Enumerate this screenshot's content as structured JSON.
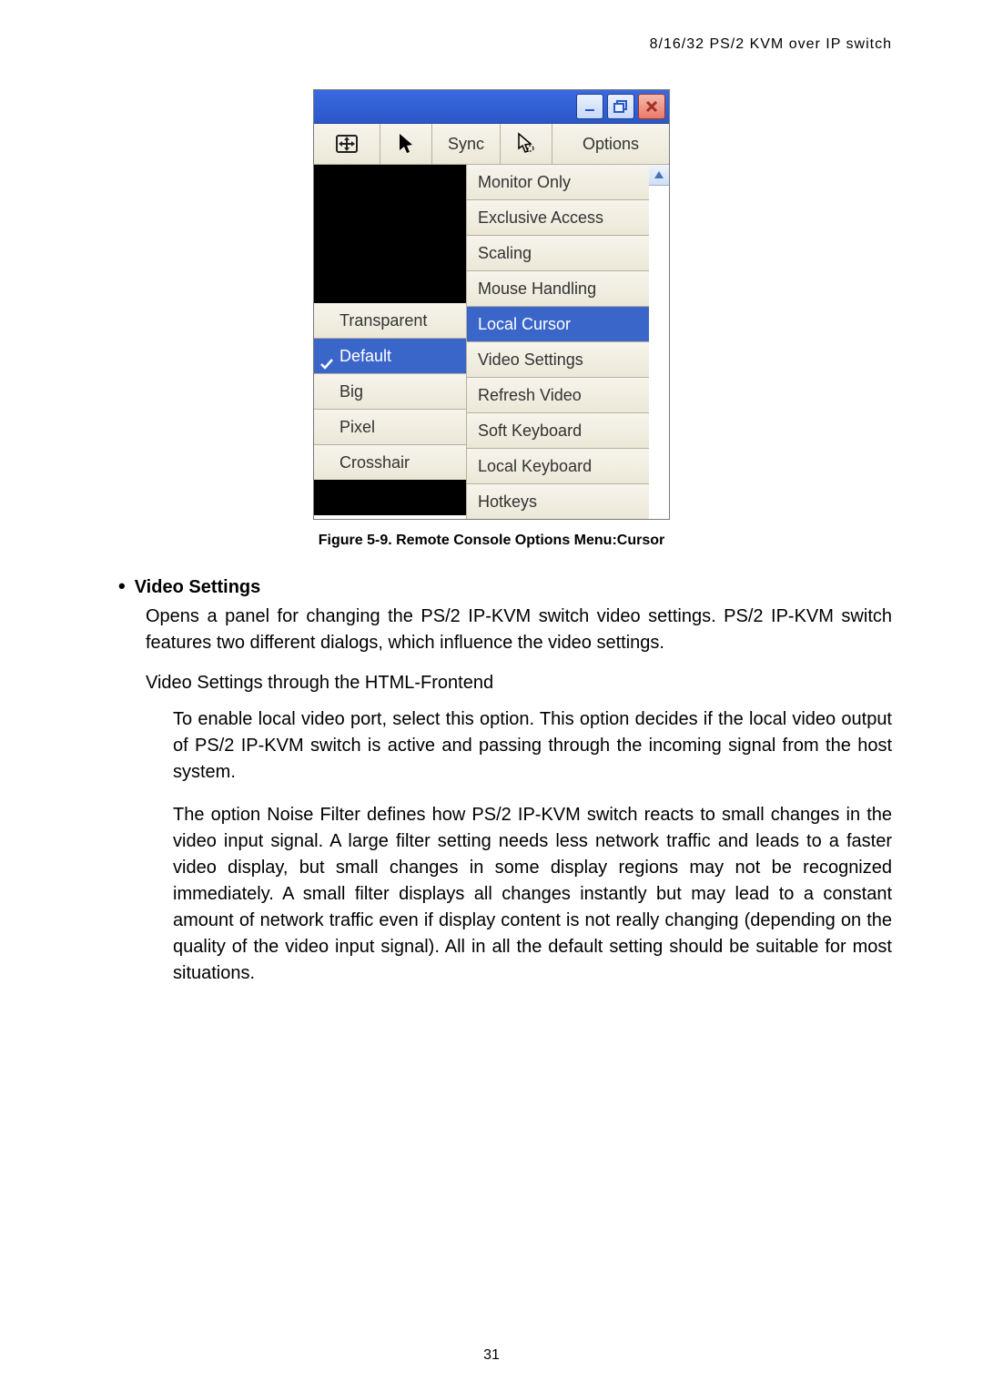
{
  "header": "8/16/32 PS/2 KVM over IP switch",
  "page_number": "31",
  "figure": {
    "caption": "Figure 5-9. Remote Console Options Menu:Cursor",
    "toolbar": {
      "sync": "Sync",
      "options": "Options"
    },
    "left_menu": {
      "transparent": "Transparent",
      "default": "Default",
      "big": "Big",
      "pixel": "Pixel",
      "crosshair": "Crosshair"
    },
    "right_menu": {
      "monitor_only": "Monitor Only",
      "exclusive_access": "Exclusive Access",
      "scaling": "Scaling",
      "mouse_handling": "Mouse Handling",
      "local_cursor": "Local Cursor",
      "video_settings": "Video Settings",
      "refresh_video": "Refresh Video",
      "soft_keyboard": "Soft Keyboard",
      "local_keyboard": "Local Keyboard",
      "hotkeys": "Hotkeys"
    }
  },
  "section": {
    "title": "Video Settings",
    "intro": "Opens a panel for changing the PS/2 IP-KVM switch video settings. PS/2 IP-KVM switch features two different dialogs, which influence the video settings.",
    "subhead": "Video Settings through the HTML-Frontend",
    "p1": "To enable local video port, select this option. This option decides if the local video output of PS/2 IP-KVM switch is active and passing through the incoming signal from the host system.",
    "p2": "The option Noise Filter defines how PS/2 IP-KVM switch reacts to small changes in the video input signal. A large filter setting needs less network traffic and leads to a faster video display, but small changes in some display regions may not be recognized immediately. A small filter displays all changes instantly but may lead to a constant amount of network traffic even if display content is not really changing (depending on the quality of the video input signal). All in all the default setting should be suitable for most situations."
  }
}
